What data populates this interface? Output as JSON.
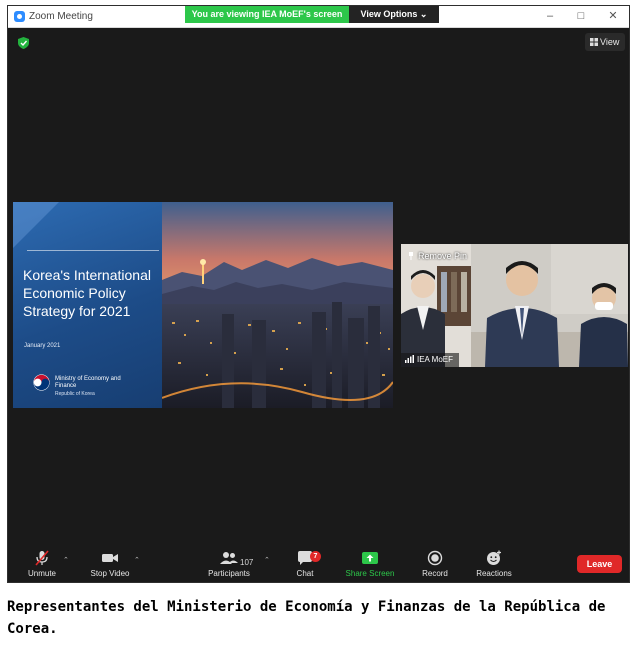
{
  "window": {
    "title": "Zoom Meeting",
    "share_banner": "You are viewing IEA MoEF's screen",
    "view_options": "View Options ⌄",
    "controls": [
      "–",
      "□",
      "✕"
    ]
  },
  "top": {
    "view_label": "View"
  },
  "slide": {
    "title": "Korea's International Economic Policy Strategy for 2021",
    "date": "January 2021",
    "ministry": "Ministry of Economy and Finance",
    "country": "Republic of Korea"
  },
  "video": {
    "remove_pin": "Remove Pin",
    "participant_name": "IEA MoEF"
  },
  "toolbar": {
    "unmute": "Unmute",
    "stop_video": "Stop Video",
    "participants": "Participants",
    "participant_count": "107",
    "chat": "Chat",
    "chat_unread": "7",
    "share_screen": "Share Screen",
    "record": "Record",
    "reactions": "Reactions",
    "leave": "Leave"
  },
  "colors": {
    "share_green": "#2dc74a",
    "leave_red": "#e02828",
    "zoom_blue": "#2d8cff"
  },
  "caption": "Representantes del Ministerio de Economía y Finanzas de la República de Corea."
}
